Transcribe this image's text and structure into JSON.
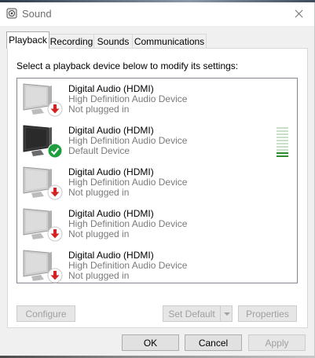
{
  "window": {
    "title": "Sound",
    "icon": "speaker-icon",
    "close_icon": "close-icon"
  },
  "tabs": [
    {
      "label": "Playback",
      "active": true
    },
    {
      "label": "Recording",
      "active": false
    },
    {
      "label": "Sounds",
      "active": false
    },
    {
      "label": "Communications",
      "active": false
    }
  ],
  "instruction": "Select a playback device below to modify its settings:",
  "devices": [
    {
      "name": "Digital Audio (HDMI)",
      "description": "High Definition Audio Device",
      "status": "Not plugged in",
      "badge": "red-down-arrow-icon"
    },
    {
      "name": "Digital Audio (HDMI)",
      "description": "High Definition Audio Device",
      "status": "Default Device",
      "badge": "green-check-icon",
      "level_meter": true
    },
    {
      "name": "Digital Audio (HDMI)",
      "description": "High Definition Audio Device",
      "status": "Not plugged in",
      "badge": "red-down-arrow-icon"
    },
    {
      "name": "Digital Audio (HDMI)",
      "description": "High Definition Audio Device",
      "status": "Not plugged in",
      "badge": "red-down-arrow-icon"
    },
    {
      "name": "Digital Audio (HDMI)",
      "description": "High Definition Audio Device",
      "status": "Not plugged in",
      "badge": "red-down-arrow-icon"
    }
  ],
  "panel_buttons": {
    "configure": "Configure",
    "set_default": "Set Default",
    "properties": "Properties"
  },
  "dialog_buttons": {
    "ok": "OK",
    "cancel": "Cancel",
    "apply": "Apply"
  },
  "colors": {
    "accent_green": "#2e8b2e",
    "status_red": "#d42020",
    "check_green": "#1e9e3e"
  }
}
